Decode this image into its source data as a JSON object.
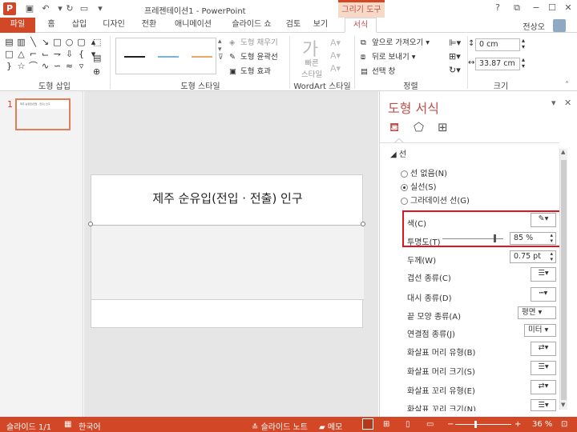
{
  "window": {
    "title": "프레젠테이션1 - PowerPoint",
    "contextual_tab_group": "그리기 도구",
    "controls": [
      "?",
      "⧉",
      "−",
      "☐",
      "✕"
    ]
  },
  "ribbon_tabs": [
    {
      "label": "파일"
    },
    {
      "label": "홈"
    },
    {
      "label": "삽입"
    },
    {
      "label": "디자인"
    },
    {
      "label": "전환"
    },
    {
      "label": "애니메이션"
    },
    {
      "label": "슬라이드 쇼"
    },
    {
      "label": "검토"
    },
    {
      "label": "보기"
    },
    {
      "label": "서식"
    }
  ],
  "user": {
    "name": "전상오"
  },
  "ribbon": {
    "insert_shapes": {
      "label": "도형 삽입"
    },
    "shape_styles": {
      "label": "도형 스타일",
      "fill": "도형 채우기",
      "outline": "도형 윤곽선",
      "effects": "도형 효과",
      "line_colors": [
        "#1f1f1f",
        "#7bb3d4",
        "#e8a866"
      ]
    },
    "wordart": {
      "label": "WordArt 스타일",
      "quick_styles_line1": "빠른",
      "quick_styles_line2": "스타일"
    },
    "arrange": {
      "label": "정렬",
      "bring_forward": "앞으로 가져오기",
      "send_backward": "뒤로 보내기",
      "selection_pane": "선택 창"
    },
    "size": {
      "label": "크기",
      "height": "0 cm",
      "width": "33.87 cm"
    }
  },
  "thumbnails": {
    "slide_number": "1",
    "thumb_title": "제주 순유입(전입 · 전출) 인구"
  },
  "slide": {
    "title": "제주 순유입(전입 · 전출) 인구"
  },
  "format_pane": {
    "title": "도형 서식",
    "section": "선",
    "options": [
      {
        "label": "선 없음(N)",
        "selected": false
      },
      {
        "label": "실선(S)",
        "selected": true
      },
      {
        "label": "그라데이션 선(G)",
        "selected": false
      }
    ],
    "properties": {
      "color": "색(C)",
      "transparency": "투명도(T)",
      "transparency_value": "85 %",
      "width": "두께(W)",
      "width_value": "0.75 pt",
      "compound": "겹선 종류(C)",
      "dash": "대시 종류(D)",
      "cap": "끝 모양 종류(A)",
      "cap_value": "평면",
      "join": "연결점 종류(J)",
      "join_value": "미터",
      "begin_arrow_type": "화살표 머리 유형(B)",
      "begin_arrow_size": "화살표 머리 크기(S)",
      "end_arrow_type": "화살표 꼬리 유형(E)",
      "end_arrow_size": "화살표 꼬리 크기(N)"
    }
  },
  "status": {
    "slide": "슬라이드 1/1",
    "language": "한국어",
    "notes": "슬라이드 노트",
    "comments": "메모",
    "zoom": "36 %"
  },
  "colors": {
    "accent": "#d24726",
    "highlight": "#e0141e"
  }
}
